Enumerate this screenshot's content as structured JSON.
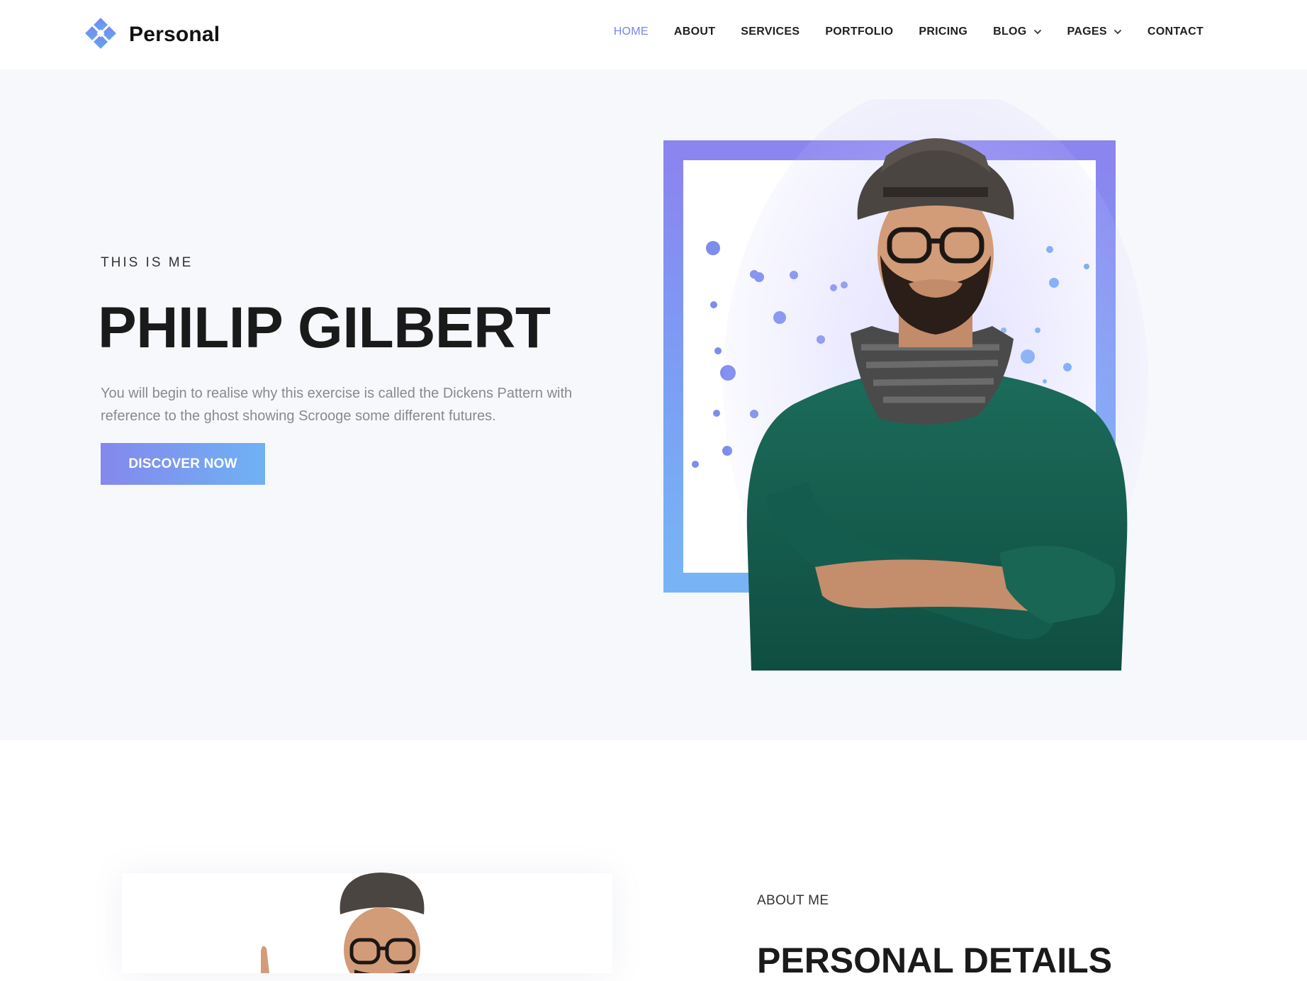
{
  "brand": {
    "name": "Personal",
    "icon": "diamond-cluster-icon",
    "color": "#6f8ff0"
  },
  "nav": {
    "items": [
      {
        "label": "HOME",
        "active": true,
        "dropdown": false
      },
      {
        "label": "ABOUT",
        "active": false,
        "dropdown": false
      },
      {
        "label": "SERVICES",
        "active": false,
        "dropdown": false
      },
      {
        "label": "PORTFOLIO",
        "active": false,
        "dropdown": false
      },
      {
        "label": "PRICING",
        "active": false,
        "dropdown": false
      },
      {
        "label": "BLOG",
        "active": false,
        "dropdown": true
      },
      {
        "label": "PAGES",
        "active": false,
        "dropdown": true
      },
      {
        "label": "CONTACT",
        "active": false,
        "dropdown": false
      }
    ],
    "active_color": "#7b84e8"
  },
  "hero": {
    "eyebrow": "THIS IS ME",
    "title": "PHILIP GILBERT",
    "description": "You will begin to realise why this exercise is called the Dickens Pattern with reference to the ghost showing Scrooge some different futures.",
    "button_label": "DISCOVER NOW",
    "accent_gradient": [
      "#8488ec",
      "#6fb2f3"
    ],
    "background": "#f7f8fc"
  },
  "about": {
    "eyebrow": "ABOUT ME",
    "title": "PERSONAL DETAILS"
  }
}
